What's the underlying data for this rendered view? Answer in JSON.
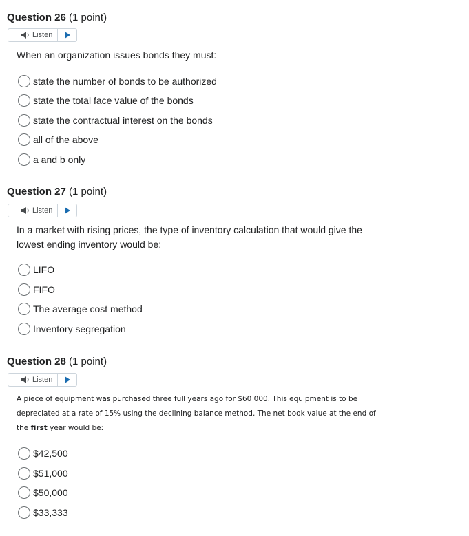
{
  "listen_label": "Listen",
  "questions": [
    {
      "number": "Question 26",
      "points": "(1 point)",
      "text_lines": [
        "When an organization issues bonds they must:"
      ],
      "options": [
        "state the number of bonds to be authorized",
        "state the total face value of the bonds",
        "state the contractual interest on the bonds",
        "all of the above",
        "a and b only"
      ]
    },
    {
      "number": "Question 27",
      "points": "(1 point)",
      "text_lines": [
        "In a market with rising prices, the type of inventory calculation that would give the",
        "lowest ending inventory would be:"
      ],
      "options": [
        "LIFO",
        "FIFO",
        "The average cost method",
        "Inventory segregation"
      ]
    },
    {
      "number": "Question 28",
      "points": "(1 point)",
      "text_lines": [
        "A piece of equipment was purchased three full years ago for $60 000.  This equipment is to be",
        "depreciated at a rate of 15% using the declining balance method.  The net book value at the end of"
      ],
      "text_line3_pre": "the ",
      "text_line3_bold": "first",
      "text_line3_post": " year would be:",
      "options": [
        "$42,500",
        "$51,000",
        "$50,000",
        "$33,333"
      ]
    }
  ]
}
